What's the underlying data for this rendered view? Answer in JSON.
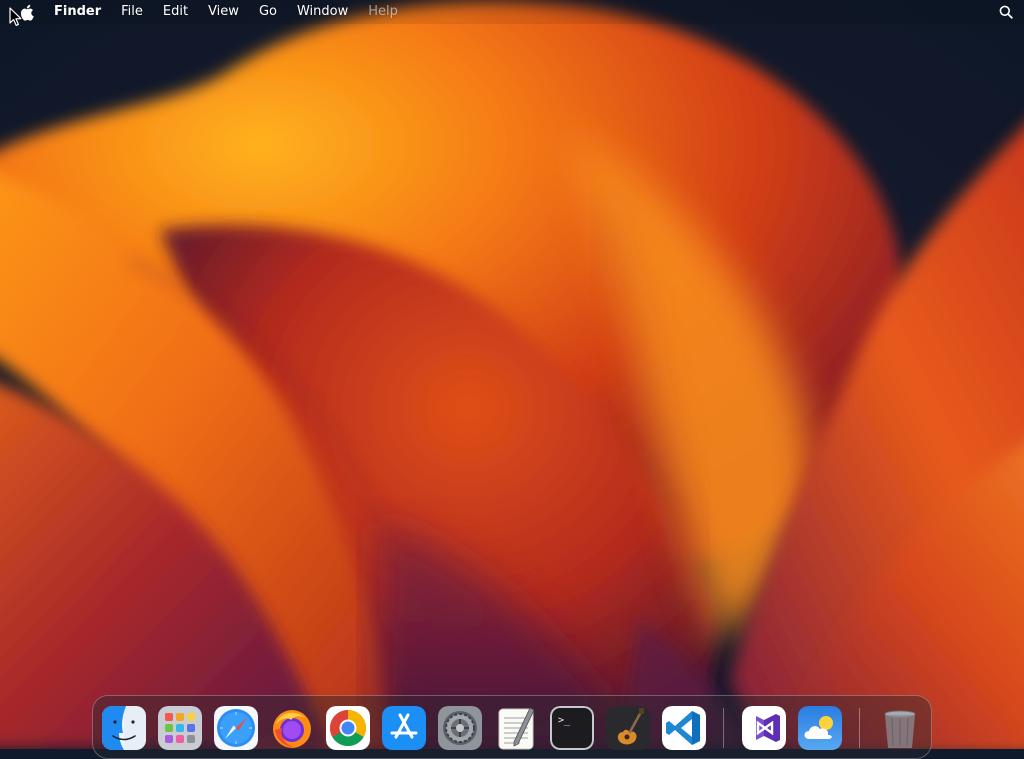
{
  "menubar": {
    "apple_icon": "apple-logo-icon",
    "app_name": "Finder",
    "menus": [
      {
        "label": "File"
      },
      {
        "label": "Edit"
      },
      {
        "label": "View"
      },
      {
        "label": "Go"
      },
      {
        "label": "Window"
      },
      {
        "label": "Help"
      }
    ],
    "right_icon": "spotlight-search-icon"
  },
  "dock": {
    "items": [
      {
        "icon": "finder-icon"
      },
      {
        "icon": "launchpad-icon"
      },
      {
        "icon": "safari-icon"
      },
      {
        "icon": "firefox-icon"
      },
      {
        "icon": "chrome-icon"
      },
      {
        "icon": "app-store-icon"
      },
      {
        "icon": "system-settings-icon"
      },
      {
        "icon": "textedit-icon"
      },
      {
        "icon": "terminal-icon"
      },
      {
        "icon": "garageband-icon"
      },
      {
        "icon": "vscode-icon"
      },
      {
        "icon": "visual-studio-icon"
      },
      {
        "icon": "weather-icon"
      },
      {
        "icon": "trash-icon"
      }
    ],
    "terminal_prompt": ">_"
  },
  "colors": {
    "wallpaper_bg": "#0f1a2c",
    "wallpaper_orange": "#f07a18",
    "wallpaper_red": "#c73a1c",
    "wallpaper_purple": "#6a1a48"
  }
}
